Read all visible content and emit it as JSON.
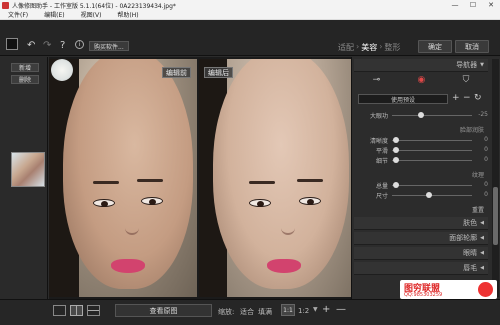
{
  "window": {
    "title": "人像修图助手 - 工作室版 5.1.1(64位) - 0A223139434.jpg*",
    "controls": [
      "—",
      "☐",
      "✕"
    ]
  },
  "menu": [
    "文件(F)",
    "编辑(E)",
    "视图(V)",
    "帮助(H)"
  ],
  "toolbar": {
    "undo": "↶",
    "redo": "↷",
    "help": "?",
    "info": "i",
    "buy_label": "购买软件...",
    "modes": [
      "适配",
      "美容",
      "整形"
    ],
    "mode_separator": "›",
    "active_mode": "美容",
    "confirm_label": "确定",
    "cancel_label": "取消"
  },
  "left_panel": {
    "new_label": "新增",
    "delete_label": "删除"
  },
  "canvas": {
    "before_label": "编辑前",
    "after_label": "编辑后"
  },
  "bottom": {
    "view_original_label": "查看原图",
    "zoom_label": "缩放:",
    "fit_label": "适合",
    "fill_label": "填满",
    "one_to_one": "1:1",
    "one_to_two": "1:2",
    "plus": "+",
    "minus": "—"
  },
  "right_panel": {
    "navigator": "导航器",
    "preset_select": "使用预设",
    "preset_controls": [
      "+",
      "−",
      "↻"
    ],
    "overall": {
      "label": "大眼功",
      "value": "-25"
    },
    "face_detail_head": "脸部润肤",
    "sliders_a": [
      {
        "label": "清晰度",
        "value": "0"
      },
      {
        "label": "平滑",
        "value": "0"
      },
      {
        "label": "细节",
        "value": "0"
      }
    ],
    "texture_head": "纹理",
    "sliders_b": [
      {
        "label": "总量",
        "value": "0"
      },
      {
        "label": "尺寸",
        "value": "0"
      }
    ],
    "reset_label": "重置",
    "sections": [
      "肤色",
      "面部轮廓",
      "眼睛",
      "唇毛"
    ],
    "expand_icon": "◀"
  },
  "watermark": {
    "main": "图穷联盟",
    "qq": "QQ:985303259"
  }
}
